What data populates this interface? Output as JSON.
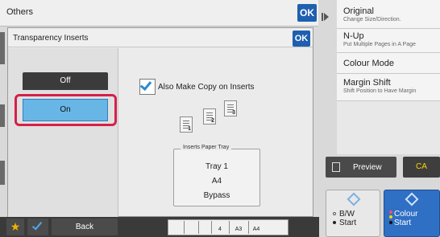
{
  "others_bar": {
    "title": "Others",
    "ok_label": "OK"
  },
  "dialog": {
    "title": "Transparency Inserts",
    "ok_label": "OK",
    "off_label": "Off",
    "on_label": "On",
    "selected": "On",
    "also_copy_label": "Also Make Copy on Inserts",
    "also_copy_checked": true,
    "insert_sheet_numbers": [
      "1",
      "2",
      "3"
    ],
    "tray": {
      "caption": "Inserts Paper Tray",
      "lines": [
        "Tray 1",
        "A4",
        "Bypass"
      ]
    }
  },
  "side_panel": {
    "items": [
      {
        "label": "Original",
        "sub": "Change Size/Direction."
      },
      {
        "label": "N-Up",
        "sub": "Put Multiple Pages in A Page"
      },
      {
        "label": "Colour Mode",
        "sub": ""
      },
      {
        "label": "Margin Shift",
        "sub": "Shift Position to Have Margin"
      }
    ],
    "preview_label": "Preview",
    "ca_label": "CA",
    "start_bw": {
      "line1": "B/W",
      "line2": "Start"
    },
    "start_colour": {
      "line1": "Colour",
      "line2": "Start"
    }
  },
  "bottom_bar": {
    "back_label": "Back",
    "tray_strip": [
      "4",
      "A3",
      "A4"
    ]
  },
  "colors": {
    "accent_blue": "#1f5fb0",
    "selected_blue": "#68b6e6",
    "highlight_red": "#d4204a",
    "ca_yellow": "#ffd400"
  },
  "icons": [
    "favorite-star-icon",
    "checkmark-icon",
    "preview-icon",
    "start-diamond-icon",
    "inserted-sheets-icon",
    "play-arrow-icon"
  ]
}
